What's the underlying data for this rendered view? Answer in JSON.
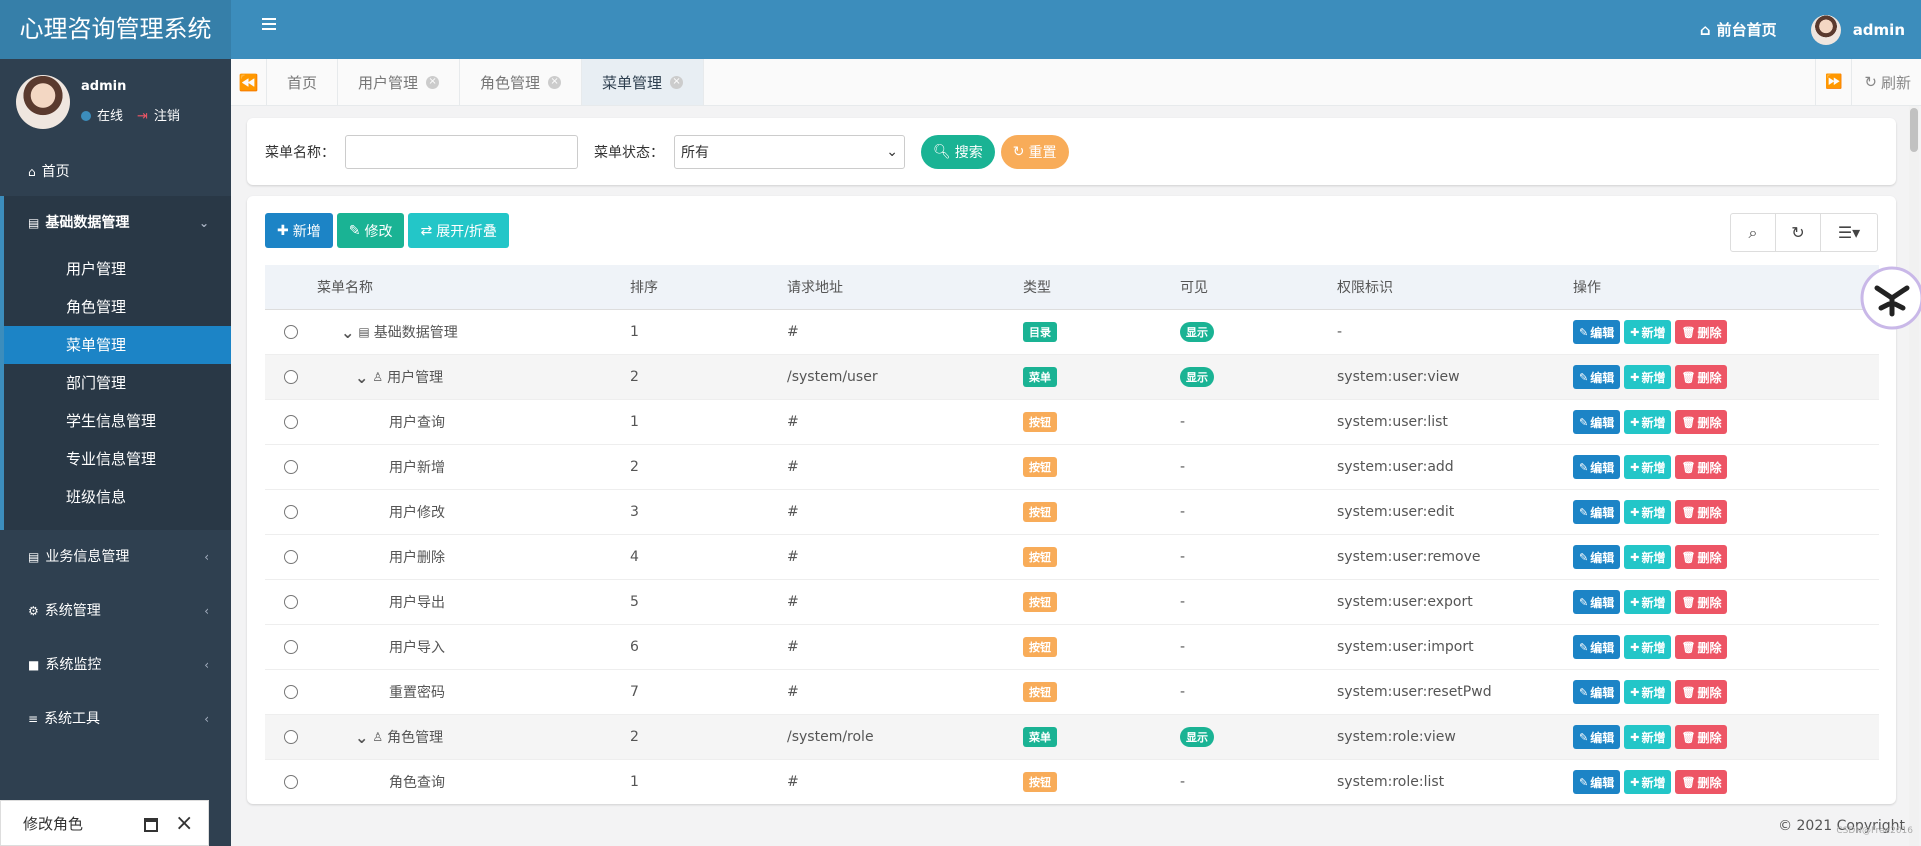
{
  "app": {
    "title": "心理咨询管理系统"
  },
  "topnav": {
    "home_label": "前台首页",
    "user_name": "admin"
  },
  "sidebar": {
    "user": {
      "name": "admin",
      "status": "在线",
      "logout": "注销"
    },
    "home": "首页",
    "group_open": {
      "label": "基础数据管理",
      "items": [
        "用户管理",
        "角色管理",
        "菜单管理",
        "部门管理",
        "学生信息管理",
        "专业信息管理",
        "班级信息"
      ],
      "active_index": 2
    },
    "groups": [
      "业务信息管理",
      "系统管理",
      "系统监控",
      "系统工具"
    ]
  },
  "tabs": {
    "items": [
      {
        "label": "首页",
        "closable": false
      },
      {
        "label": "用户管理",
        "closable": true
      },
      {
        "label": "角色管理",
        "closable": true
      },
      {
        "label": "菜单管理",
        "closable": true,
        "active": true
      }
    ],
    "refresh": "刷新"
  },
  "search": {
    "name_label": "菜单名称：",
    "name_value": "",
    "status_label": "菜单状态：",
    "status_value": "所有",
    "search_btn": "搜索",
    "reset_btn": "重置"
  },
  "toolbar": {
    "add": "新增",
    "edit": "修改",
    "expand": "展开/折叠"
  },
  "table": {
    "headers": [
      "菜单名称",
      "排序",
      "请求地址",
      "类型",
      "可见",
      "权限标识",
      "操作"
    ],
    "actions": {
      "edit": "编辑",
      "add": "新增",
      "delete": "删除"
    },
    "rows": [
      {
        "name": "基础数据管理",
        "level": 0,
        "order": "1",
        "url": "#",
        "type": "目录",
        "visible": "显示",
        "perm": "-"
      },
      {
        "name": "用户管理",
        "level": 1,
        "order": "2",
        "url": "/system/user",
        "type": "菜单",
        "visible": "显示",
        "perm": "system:user:view"
      },
      {
        "name": "用户查询",
        "level": 2,
        "order": "1",
        "url": "#",
        "type": "按钮",
        "visible": "-",
        "perm": "system:user:list"
      },
      {
        "name": "用户新增",
        "level": 2,
        "order": "2",
        "url": "#",
        "type": "按钮",
        "visible": "-",
        "perm": "system:user:add"
      },
      {
        "name": "用户修改",
        "level": 2,
        "order": "3",
        "url": "#",
        "type": "按钮",
        "visible": "-",
        "perm": "system:user:edit"
      },
      {
        "name": "用户删除",
        "level": 2,
        "order": "4",
        "url": "#",
        "type": "按钮",
        "visible": "-",
        "perm": "system:user:remove"
      },
      {
        "name": "用户导出",
        "level": 2,
        "order": "5",
        "url": "#",
        "type": "按钮",
        "visible": "-",
        "perm": "system:user:export"
      },
      {
        "name": "用户导入",
        "level": 2,
        "order": "6",
        "url": "#",
        "type": "按钮",
        "visible": "-",
        "perm": "system:user:import"
      },
      {
        "name": "重置密码",
        "level": 2,
        "order": "7",
        "url": "#",
        "type": "按钮",
        "visible": "-",
        "perm": "system:user:resetPwd"
      },
      {
        "name": "角色管理",
        "level": 1,
        "order": "2",
        "url": "/system/role",
        "type": "菜单",
        "visible": "显示",
        "perm": "system:role:view"
      },
      {
        "name": "角色查询",
        "level": 2,
        "order": "1",
        "url": "#",
        "type": "按钮",
        "visible": "-",
        "perm": "system:role:list"
      }
    ]
  },
  "footer": {
    "popup_title": "修改角色",
    "copyright": "© 2021 Copyright",
    "watermark": "CSDN@Free2016"
  },
  "colors": {
    "primary": "#3c8dbc",
    "sidebar": "#2f4050",
    "active": "#1c84c6",
    "green": "#1ab394",
    "orange": "#f8ac59",
    "cyan": "#23c6c8",
    "red": "#ed5565"
  }
}
